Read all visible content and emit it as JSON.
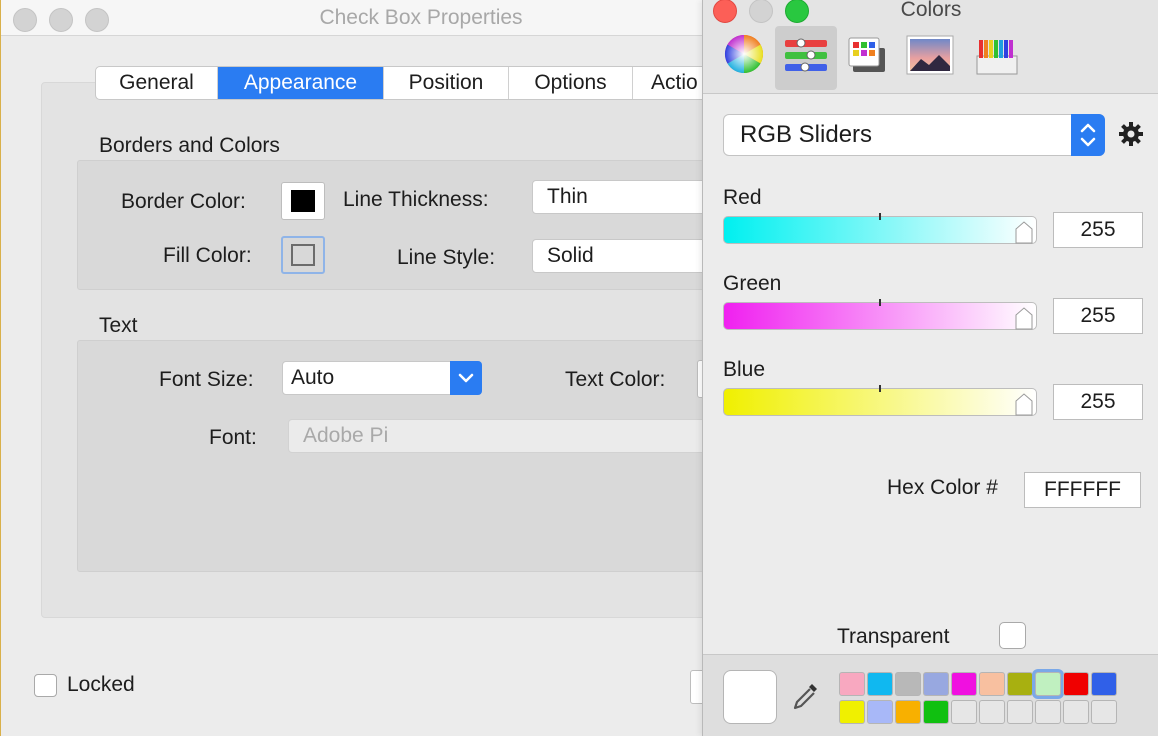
{
  "props_window": {
    "title": "Check Box Properties",
    "tabs": [
      {
        "label": "General"
      },
      {
        "label": "Appearance"
      },
      {
        "label": "Position"
      },
      {
        "label": "Options"
      },
      {
        "label": "Actio"
      }
    ],
    "borders_section": {
      "heading": "Borders and Colors",
      "border_color_label": "Border Color:",
      "fill_color_label": "Fill Color:",
      "line_thickness_label": "Line Thickness:",
      "line_thickness_value": "Thin",
      "line_style_label": "Line Style:",
      "line_style_value": "Solid",
      "border_color": "#000000",
      "fill_color": "transparent"
    },
    "text_section": {
      "heading": "Text",
      "font_size_label": "Font Size:",
      "font_size_value": "Auto",
      "text_color_label": "Text Color:",
      "font_label": "Font:",
      "font_value": "Adobe Pi"
    },
    "locked_label": "Locked",
    "locked_checked": false
  },
  "colors_panel": {
    "title": "Colors",
    "modes": [
      {
        "icon": "color-wheel-icon"
      },
      {
        "icon": "color-sliders-icon",
        "active": true
      },
      {
        "icon": "color-palettes-icon"
      },
      {
        "icon": "image-palettes-icon"
      },
      {
        "icon": "pencils-icon"
      }
    ],
    "slider_mode": "RGB Sliders",
    "sliders": [
      {
        "label": "Red",
        "value": "255",
        "gradient_from": "#00f0f0",
        "gradient_to": "#ffffff"
      },
      {
        "label": "Green",
        "value": "255",
        "gradient_from": "#f020f0",
        "gradient_to": "#ffffff"
      },
      {
        "label": "Blue",
        "value": "255",
        "gradient_from": "#f0f000",
        "gradient_to": "#ffffff"
      }
    ],
    "hex_label": "Hex Color #",
    "hex_value": "FFFFFF",
    "transparent_label": "Transparent",
    "current_color": "#ffffff",
    "swatches_row1": [
      "#f8a8c0",
      "#10b8f0",
      "#b8b8b8",
      "#98a8e0",
      "#f010e0",
      "#f8c0a0",
      "#a8b010",
      "#c0f0c0",
      "#f00000",
      "#3060e8"
    ],
    "swatches_row2": [
      "#f0f000",
      "#a8b8f8",
      "#f8b000",
      "#10c010",
      "",
      "",
      "",
      "",
      "",
      ""
    ],
    "selected_swatch_index": 7
  }
}
